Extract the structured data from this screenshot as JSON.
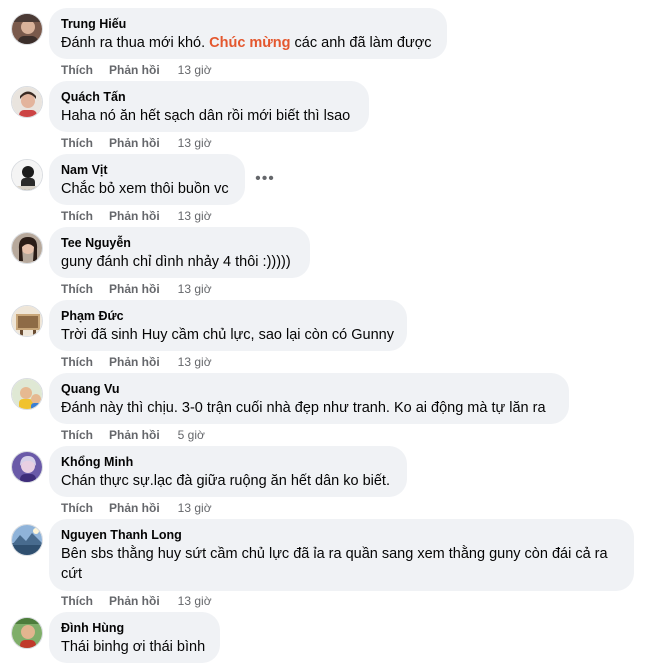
{
  "comments": [
    {
      "name": "Trung Hiếu",
      "text_before": "Đánh ra thua mới khó. ",
      "highlight": "Chúc mừng",
      "text_after": " các anh đã làm được",
      "like": "Thích",
      "reply": "Phản hồi",
      "time": "13 giờ"
    },
    {
      "name": "Quách Tấn",
      "text": "Haha nó ăn hết sạch dân rồi mới biết thì lsao",
      "like": "Thích",
      "reply": "Phản hồi",
      "time": "13 giờ"
    },
    {
      "name": "Nam Vịt",
      "text": "Chắc bỏ xem thôi buồn vc",
      "like": "Thích",
      "reply": "Phản hồi",
      "time": "13 giờ",
      "more": "•••"
    },
    {
      "name": "Tee Nguyễn",
      "text": "guny đánh chỉ dình nhảy 4 thôi :)))))",
      "like": "Thích",
      "reply": "Phản hồi",
      "time": "13 giờ"
    },
    {
      "name": "Phạm Đức",
      "text": "Trời đã sinh Huy cầm chủ lực, sao lại còn có Gunny",
      "like": "Thích",
      "reply": "Phản hồi",
      "time": "13 giờ"
    },
    {
      "name": "Quang Vu",
      "text": "Đánh này thì chịu. 3-0 trận cuối nhà đẹp như tranh. Ko ai động mà tự lăn ra",
      "like": "Thích",
      "reply": "Phản hồi",
      "time": "5 giờ"
    },
    {
      "name": "Khổng Minh",
      "text": "Chán thực sự.lạc đà giữa ruộng ăn hết dân ko biết.",
      "like": "Thích",
      "reply": "Phản hồi",
      "time": "13 giờ"
    },
    {
      "name": "Nguyen Thanh Long",
      "text": "Bên sbs thằng huy sứt cầm chủ lực đã ỉa ra quần sang xem thằng guny còn đái cả ra cứt",
      "like": "Thích",
      "reply": "Phản hồi",
      "time": "13 giờ"
    },
    {
      "name": "Đình Hùng",
      "text": "Thái binhg ơi thái bình"
    }
  ],
  "colors": {
    "bubble": "#f0f2f5",
    "secondary_text": "#65676b",
    "highlight": "#e4572e"
  }
}
